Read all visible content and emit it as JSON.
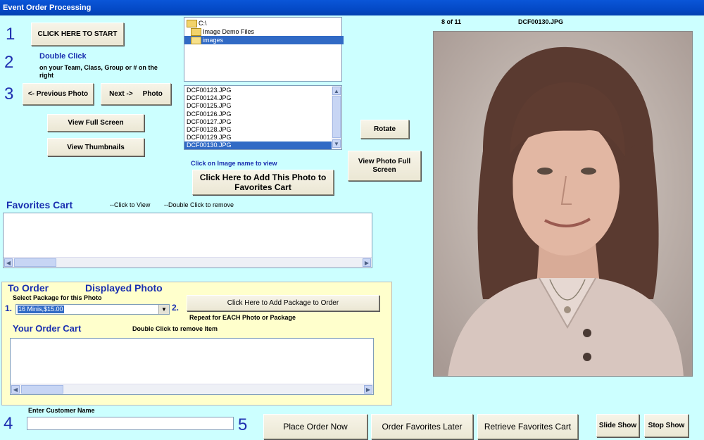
{
  "window": {
    "title": "Event Order Processing"
  },
  "steps": {
    "s1": "1",
    "s2": "2",
    "s3": "3",
    "s4": "4",
    "s5": "5"
  },
  "buttons": {
    "start": "CLICK HERE TO START",
    "prev": "<- Previous  Photo",
    "next": "Next ->     Photo",
    "view_full": "View Full Screen",
    "view_thumbs": "View Thumbnails",
    "rotate": "Rotate",
    "view_photo_full": "View Photo Full Screen",
    "add_favorites": "Click Here to Add This Photo to Favorites Cart",
    "add_package": "Click Here to Add Package to Order",
    "place_order": "Place Order Now",
    "order_fav_later": "Order Favorites Later",
    "retrieve_fav": "Retrieve Favorites Cart",
    "slide_show": "Slide Show",
    "stop_show": "Stop Show"
  },
  "instructions": {
    "double_click_title": "Double Click",
    "double_click_desc": "on your Team, Class, Group or # on the right",
    "click_image_name": "Click on Image name to view"
  },
  "folders": {
    "items": [
      "C:\\",
      "Image Demo Files",
      "images"
    ]
  },
  "files": {
    "items": [
      "DCF00123.JPG",
      "DCF00124.JPG",
      "DCF00125.JPG",
      "DCF00126.JPG",
      "DCF00127.JPG",
      "DCF00128.JPG",
      "DCF00129.JPG",
      "DCF00130.JPG"
    ],
    "selected": "DCF00130.JPG"
  },
  "photo": {
    "counter": "8 of 11",
    "filename": "DCF00130.JPG"
  },
  "favorites": {
    "title": "Favorites Cart",
    "hint_view": "--Click to View",
    "hint_remove": "--Double Click to remove"
  },
  "order": {
    "to_order": "To Order",
    "displayed_photo": "Displayed Photo",
    "select_package_label": "Select Package for this Photo",
    "num1": "1.",
    "num2": "2.",
    "package_value": "16 Minis,$15.00",
    "repeat_hint": "Repeat for EACH Photo or Package",
    "cart_title": "Your Order Cart",
    "cart_hint": "Double Click to remove Item"
  },
  "customer": {
    "label": "Enter Customer Name",
    "value": ""
  },
  "colors": {
    "background": "#ccffff",
    "accent_blue": "#1a2fb0",
    "order_panel": "#ffffcc",
    "selection": "#316ac5"
  }
}
